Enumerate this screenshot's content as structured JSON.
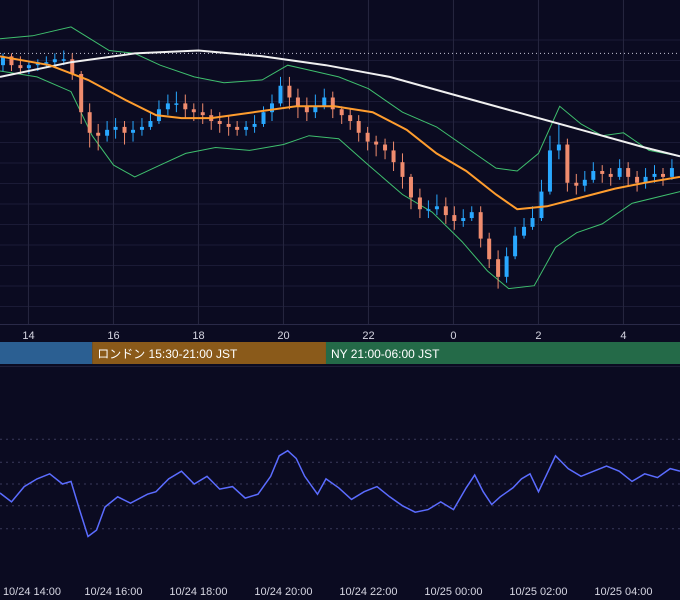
{
  "chart_data": [
    {
      "type": "candlestick",
      "title": "",
      "x_tick_labels": [
        "14",
        "16",
        "18",
        "20",
        "22",
        "0",
        "2",
        "4"
      ],
      "x_tick_hours": [
        14,
        16,
        18,
        20,
        22,
        24,
        26,
        28
      ],
      "x_range_hours": [
        13.33,
        29.33
      ],
      "price_range_rel": [
        0,
        100
      ],
      "reference_line_rel": 90,
      "colors": {
        "up": "#29a8ff",
        "down": "#f08c6e",
        "ma_long": "#f0f0f0",
        "ma_mid": "#ff9d2e",
        "bands": "#3fbf6e",
        "ref_line": "#c8c8d8"
      },
      "close_path_rel": [
        [
          13.33,
          88
        ],
        [
          14.0,
          85
        ],
        [
          14.5,
          87
        ],
        [
          14.9,
          89
        ],
        [
          15.15,
          72
        ],
        [
          15.4,
          60
        ],
        [
          15.7,
          63
        ],
        [
          16.1,
          65
        ],
        [
          16.5,
          62
        ],
        [
          16.8,
          66
        ],
        [
          17.1,
          71
        ],
        [
          17.5,
          74
        ],
        [
          17.9,
          70
        ],
        [
          18.2,
          68
        ],
        [
          18.6,
          66
        ],
        [
          19.0,
          64
        ],
        [
          19.4,
          66
        ],
        [
          19.8,
          73
        ],
        [
          20.0,
          80
        ],
        [
          20.3,
          72
        ],
        [
          20.6,
          70
        ],
        [
          20.9,
          76
        ],
        [
          21.2,
          70
        ],
        [
          21.5,
          68
        ],
        [
          21.8,
          62
        ],
        [
          22.1,
          59
        ],
        [
          22.4,
          57
        ],
        [
          22.8,
          48
        ],
        [
          23.1,
          38
        ],
        [
          23.4,
          37
        ],
        [
          23.7,
          39
        ],
        [
          24.0,
          32
        ],
        [
          24.4,
          36
        ],
        [
          24.6,
          28
        ],
        [
          24.8,
          22
        ],
        [
          25.0,
          13
        ],
        [
          25.2,
          20
        ],
        [
          25.5,
          31
        ],
        [
          25.8,
          31
        ],
        [
          26.0,
          41
        ],
        [
          26.2,
          56
        ],
        [
          26.4,
          60
        ],
        [
          26.7,
          44
        ],
        [
          27.0,
          46
        ],
        [
          27.3,
          50
        ],
        [
          27.6,
          48
        ],
        [
          28.0,
          51
        ],
        [
          28.3,
          46
        ],
        [
          28.6,
          49
        ],
        [
          28.9,
          48
        ],
        [
          29.2,
          51
        ],
        [
          29.33,
          49
        ]
      ],
      "ma_long_rel": [
        [
          13.33,
          82
        ],
        [
          15.0,
          87
        ],
        [
          16.5,
          90
        ],
        [
          18.0,
          91
        ],
        [
          19.5,
          89
        ],
        [
          21.0,
          86
        ],
        [
          22.5,
          82
        ],
        [
          24.0,
          76
        ],
        [
          25.5,
          70
        ],
        [
          27.0,
          64
        ],
        [
          28.5,
          58
        ],
        [
          29.33,
          55
        ]
      ],
      "ma_mid_rel": [
        [
          13.33,
          89
        ],
        [
          14.5,
          86
        ],
        [
          15.4,
          81
        ],
        [
          16.3,
          74
        ],
        [
          17.0,
          69
        ],
        [
          17.6,
          68
        ],
        [
          18.3,
          68
        ],
        [
          19.3,
          70
        ],
        [
          20.3,
          72
        ],
        [
          21.2,
          72
        ],
        [
          22.1,
          70
        ],
        [
          22.9,
          64
        ],
        [
          23.6,
          56
        ],
        [
          24.3,
          50
        ],
        [
          25.0,
          42
        ],
        [
          25.5,
          37
        ],
        [
          26.2,
          38
        ],
        [
          27.0,
          41
        ],
        [
          27.8,
          44
        ],
        [
          28.5,
          46
        ],
        [
          29.33,
          48
        ]
      ],
      "band_upper_rel": [
        [
          13.33,
          95
        ],
        [
          14.1,
          96
        ],
        [
          15.0,
          99
        ],
        [
          15.9,
          91
        ],
        [
          16.5,
          90
        ],
        [
          17.1,
          86
        ],
        [
          17.9,
          82
        ],
        [
          18.6,
          80
        ],
        [
          19.5,
          81
        ],
        [
          20.1,
          86
        ],
        [
          20.7,
          84
        ],
        [
          21.3,
          82
        ],
        [
          22.0,
          78
        ],
        [
          22.8,
          70
        ],
        [
          23.6,
          65
        ],
        [
          24.3,
          58
        ],
        [
          25.0,
          51
        ],
        [
          25.5,
          50
        ],
        [
          26.0,
          56
        ],
        [
          26.5,
          72
        ],
        [
          27.0,
          66
        ],
        [
          27.5,
          62
        ],
        [
          28.0,
          63
        ],
        [
          28.6,
          57
        ],
        [
          29.33,
          55
        ]
      ],
      "band_lower_rel": [
        [
          13.33,
          84
        ],
        [
          14.2,
          82
        ],
        [
          15.0,
          77
        ],
        [
          15.5,
          62
        ],
        [
          16.0,
          52
        ],
        [
          16.5,
          48
        ],
        [
          17.1,
          52
        ],
        [
          17.7,
          56
        ],
        [
          18.4,
          58
        ],
        [
          19.2,
          57
        ],
        [
          20.0,
          59
        ],
        [
          20.6,
          62
        ],
        [
          21.3,
          61
        ],
        [
          22.0,
          52
        ],
        [
          22.8,
          42
        ],
        [
          23.5,
          36
        ],
        [
          24.2,
          26
        ],
        [
          24.8,
          16
        ],
        [
          25.3,
          10
        ],
        [
          25.9,
          11
        ],
        [
          26.4,
          24
        ],
        [
          26.9,
          29
        ],
        [
          27.5,
          32
        ],
        [
          28.2,
          39
        ],
        [
          29.33,
          43
        ]
      ],
      "source_candle_rel": [
        [
          13.4,
          86,
          89,
          84,
          90
        ],
        [
          13.6,
          89,
          86,
          84,
          90
        ],
        [
          13.81,
          86,
          85,
          83,
          89
        ],
        [
          14.01,
          85,
          86,
          83,
          87
        ],
        [
          14.22,
          86,
          87,
          84,
          88
        ],
        [
          14.42,
          87,
          87,
          85,
          89
        ],
        [
          14.62,
          87,
          88,
          85,
          90
        ],
        [
          14.83,
          88,
          88,
          86,
          91
        ],
        [
          15.03,
          88,
          83,
          81,
          90
        ],
        [
          15.24,
          83,
          70,
          66,
          84
        ],
        [
          15.44,
          70,
          63,
          58,
          73
        ],
        [
          15.64,
          63,
          62,
          57,
          66
        ],
        [
          15.85,
          62,
          64,
          60,
          67
        ],
        [
          16.05,
          64,
          65,
          61,
          68
        ],
        [
          16.26,
          65,
          63,
          59,
          67
        ],
        [
          16.46,
          63,
          64,
          60,
          67
        ],
        [
          16.67,
          64,
          65,
          62,
          68
        ],
        [
          16.87,
          65,
          67,
          64,
          70
        ],
        [
          17.07,
          67,
          71,
          66,
          74
        ],
        [
          17.28,
          71,
          73,
          69,
          76
        ],
        [
          17.48,
          73,
          73,
          70,
          77
        ],
        [
          17.69,
          73,
          71,
          68,
          76
        ],
        [
          17.89,
          71,
          70,
          67,
          73
        ],
        [
          18.1,
          70,
          69,
          66,
          73
        ],
        [
          18.3,
          69,
          67,
          64,
          71
        ],
        [
          18.5,
          67,
          66,
          63,
          70
        ],
        [
          18.71,
          66,
          65,
          62,
          69
        ],
        [
          18.91,
          65,
          64,
          62,
          67
        ],
        [
          19.12,
          64,
          65,
          62,
          67
        ],
        [
          19.32,
          65,
          66,
          63,
          69
        ],
        [
          19.53,
          66,
          70,
          65,
          72
        ],
        [
          19.73,
          70,
          73,
          67,
          76
        ],
        [
          19.93,
          73,
          79,
          72,
          82
        ],
        [
          20.14,
          79,
          75,
          71,
          82
        ],
        [
          20.34,
          75,
          72,
          68,
          78
        ],
        [
          20.55,
          72,
          70,
          67,
          75
        ],
        [
          20.75,
          70,
          72,
          68,
          76
        ],
        [
          20.96,
          72,
          75,
          71,
          78
        ],
        [
          21.16,
          75,
          71,
          68,
          77
        ],
        [
          21.37,
          71,
          69,
          66,
          72
        ],
        [
          21.57,
          69,
          67,
          64,
          71
        ],
        [
          21.77,
          67,
          63,
          60,
          69
        ],
        [
          21.98,
          63,
          60,
          57,
          65
        ],
        [
          22.18,
          60,
          59,
          55,
          62
        ],
        [
          22.39,
          59,
          57,
          54,
          61
        ],
        [
          22.59,
          57,
          53,
          50,
          60
        ],
        [
          22.8,
          53,
          48,
          44,
          56
        ],
        [
          23.0,
          48,
          41,
          37,
          49
        ],
        [
          23.21,
          41,
          37,
          34,
          44
        ],
        [
          23.41,
          37,
          37,
          34,
          40
        ],
        [
          23.61,
          37,
          38,
          35,
          42
        ],
        [
          23.82,
          38,
          35,
          32,
          41
        ],
        [
          24.02,
          35,
          33,
          30,
          38
        ],
        [
          24.23,
          33,
          34,
          31,
          37
        ],
        [
          24.43,
          34,
          36,
          33,
          38
        ],
        [
          24.64,
          36,
          27,
          24,
          38
        ],
        [
          24.84,
          27,
          20,
          17,
          29
        ],
        [
          25.05,
          20,
          14,
          10,
          23
        ],
        [
          25.25,
          14,
          21,
          12,
          24
        ],
        [
          25.45,
          21,
          28,
          20,
          31
        ],
        [
          25.66,
          28,
          31,
          27,
          34
        ],
        [
          25.86,
          31,
          34,
          30,
          38
        ],
        [
          26.07,
          34,
          43,
          33,
          47
        ],
        [
          26.27,
          43,
          57,
          42,
          62
        ],
        [
          26.48,
          57,
          59,
          54,
          66
        ],
        [
          26.68,
          59,
          46,
          43,
          61
        ],
        [
          26.89,
          46,
          45,
          42,
          49
        ],
        [
          27.09,
          45,
          47,
          43,
          50
        ],
        [
          27.29,
          47,
          50,
          46,
          53
        ],
        [
          27.5,
          50,
          49,
          46,
          52
        ],
        [
          27.7,
          49,
          48,
          45,
          51
        ],
        [
          27.91,
          48,
          51,
          47,
          54
        ],
        [
          28.11,
          51,
          48,
          45,
          53
        ],
        [
          28.32,
          48,
          46,
          43,
          50
        ],
        [
          28.52,
          46,
          48,
          44,
          51
        ],
        [
          28.73,
          48,
          49,
          46,
          52
        ],
        [
          28.93,
          49,
          48,
          45,
          51
        ],
        [
          29.14,
          48,
          51,
          47,
          54
        ]
      ]
    },
    {
      "type": "line",
      "title": "",
      "x_tick_labels": [
        "10/24 14:00",
        "10/24 16:00",
        "10/24 18:00",
        "10/24 20:00",
        "10/24 22:00",
        "10/25 00:00",
        "10/25 02:00",
        "10/25 04:00"
      ],
      "x_tick_hours": [
        14,
        16,
        18,
        20,
        22,
        24,
        26,
        28
      ],
      "x_range_hours": [
        13.33,
        29.33
      ],
      "y_range_rel": [
        0,
        100
      ],
      "grid_levels_rel": [
        15,
        33,
        50,
        67,
        85
      ],
      "line_color": "#5b6cff",
      "values_rel": [
        [
          13.33,
          43
        ],
        [
          13.6,
          36
        ],
        [
          13.9,
          48
        ],
        [
          14.2,
          54
        ],
        [
          14.5,
          58
        ],
        [
          14.8,
          50
        ],
        [
          15.0,
          52
        ],
        [
          15.2,
          30
        ],
        [
          15.4,
          9
        ],
        [
          15.6,
          14
        ],
        [
          15.8,
          32
        ],
        [
          16.1,
          40
        ],
        [
          16.4,
          35
        ],
        [
          16.8,
          42
        ],
        [
          17.0,
          44
        ],
        [
          17.3,
          54
        ],
        [
          17.6,
          60
        ],
        [
          17.9,
          50
        ],
        [
          18.2,
          56
        ],
        [
          18.5,
          46
        ],
        [
          18.8,
          48
        ],
        [
          19.1,
          39
        ],
        [
          19.4,
          42
        ],
        [
          19.7,
          56
        ],
        [
          19.9,
          72
        ],
        [
          20.1,
          76
        ],
        [
          20.3,
          70
        ],
        [
          20.5,
          56
        ],
        [
          20.8,
          42
        ],
        [
          21.0,
          54
        ],
        [
          21.3,
          47
        ],
        [
          21.6,
          38
        ],
        [
          21.9,
          44
        ],
        [
          22.2,
          48
        ],
        [
          22.5,
          40
        ],
        [
          22.8,
          33
        ],
        [
          23.1,
          28
        ],
        [
          23.4,
          30
        ],
        [
          23.7,
          36
        ],
        [
          24.0,
          30
        ],
        [
          24.3,
          47
        ],
        [
          24.5,
          57
        ],
        [
          24.7,
          44
        ],
        [
          24.9,
          34
        ],
        [
          25.1,
          40
        ],
        [
          25.4,
          47
        ],
        [
          25.6,
          54
        ],
        [
          25.8,
          58
        ],
        [
          26.0,
          44
        ],
        [
          26.2,
          58
        ],
        [
          26.4,
          72
        ],
        [
          26.7,
          62
        ],
        [
          27.0,
          56
        ],
        [
          27.3,
          60
        ],
        [
          27.6,
          64
        ],
        [
          27.9,
          60
        ],
        [
          28.2,
          52
        ],
        [
          28.5,
          58
        ],
        [
          28.8,
          55
        ],
        [
          29.1,
          62
        ],
        [
          29.33,
          60
        ]
      ]
    }
  ],
  "sessions": [
    {
      "label": "",
      "color": "#2b5f92",
      "start_hour": 13.33,
      "end_hour": 15.5
    },
    {
      "label": "ロンドン 15:30-21:00 JST",
      "color": "#8a5a1a",
      "start_hour": 15.5,
      "end_hour": 21.0
    },
    {
      "label": "NY 21:00-06:00 JST",
      "color": "#246a48",
      "start_hour": 21.0,
      "end_hour": 29.33
    }
  ]
}
